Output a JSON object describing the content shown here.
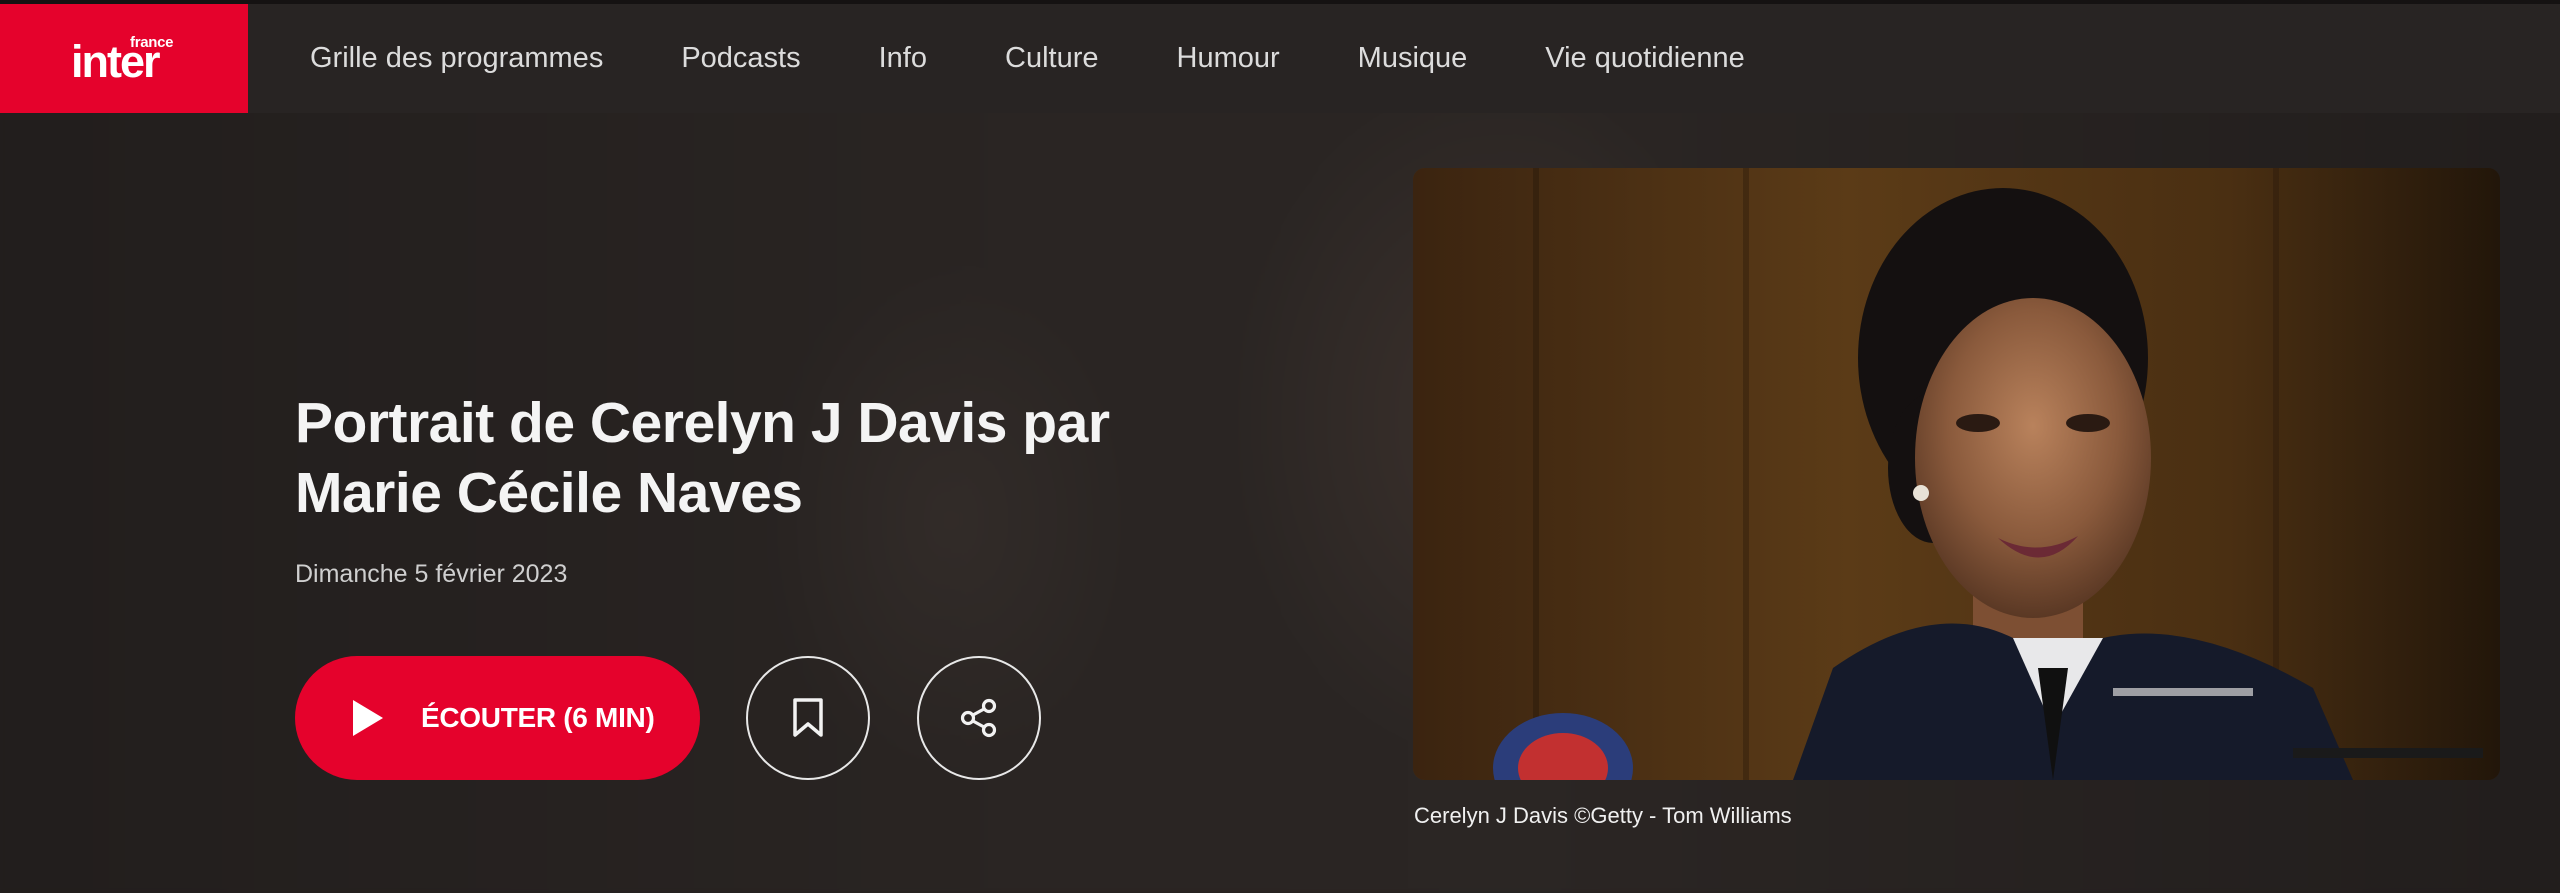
{
  "brand": {
    "small": "france",
    "main": "inter",
    "color": "#e5022c"
  },
  "nav": {
    "items": [
      {
        "label": "Grille des programmes"
      },
      {
        "label": "Podcasts"
      },
      {
        "label": "Info"
      },
      {
        "label": "Culture"
      },
      {
        "label": "Humour"
      },
      {
        "label": "Musique"
      },
      {
        "label": "Vie quotidienne"
      }
    ]
  },
  "episode": {
    "title": "Portrait de Cerelyn J Davis par Marie Cécile Naves",
    "date": "Dimanche 5 février 2023",
    "listen_label": "ÉCOUTER (6 MIN)",
    "photo_caption": "Cerelyn J Davis ©Getty - Tom Williams",
    "icons": {
      "play": "play-icon",
      "bookmark": "bookmark-icon",
      "share": "share-icon"
    }
  }
}
